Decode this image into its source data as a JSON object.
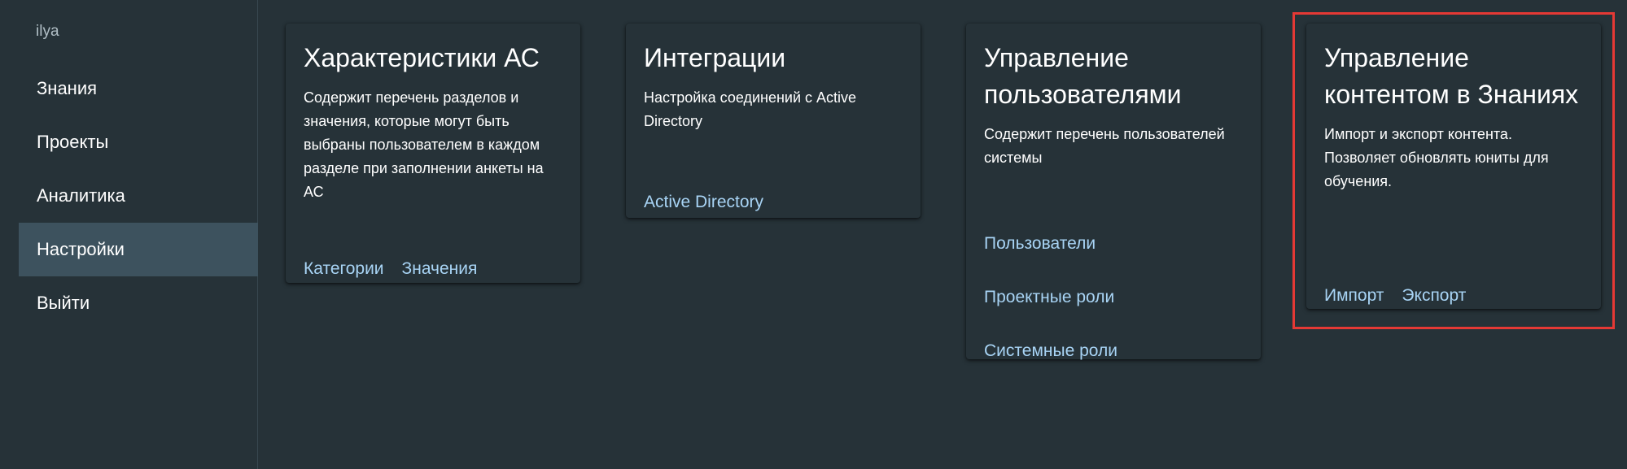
{
  "sidebar": {
    "user": "ilya",
    "items": [
      {
        "label": "Знания"
      },
      {
        "label": "Проекты"
      },
      {
        "label": "Аналитика"
      },
      {
        "label": "Настройки"
      },
      {
        "label": "Выйти"
      }
    ],
    "active_item": "Настройки"
  },
  "cards": [
    {
      "title": "Характеристики АС",
      "description": "Содержит перечень разделов и значения, которые могут быть выбраны пользователем в каждом разделе при заполнении анкеты на АС",
      "links": [
        "Категории",
        "Значения"
      ]
    },
    {
      "title": "Интеграции",
      "description": "Настройка соединений с Active Directory",
      "links": [
        "Active Directory"
      ]
    },
    {
      "title": "Управление пользователями",
      "description": "Содержит перечень пользователей системы",
      "links": [
        "Пользователи",
        "Проектные роли",
        "Системные роли"
      ]
    },
    {
      "title": "Управление контентом в Знаниях",
      "description": "Импорт и экспорт контента. Позволяет обновлять юниты для обучения.",
      "links": [
        "Импорт",
        "Экспорт"
      ]
    }
  ],
  "colors": {
    "background": "#263238",
    "active_nav": "#3d525e",
    "link": "#a8d4f5",
    "highlight": "#e53935"
  }
}
